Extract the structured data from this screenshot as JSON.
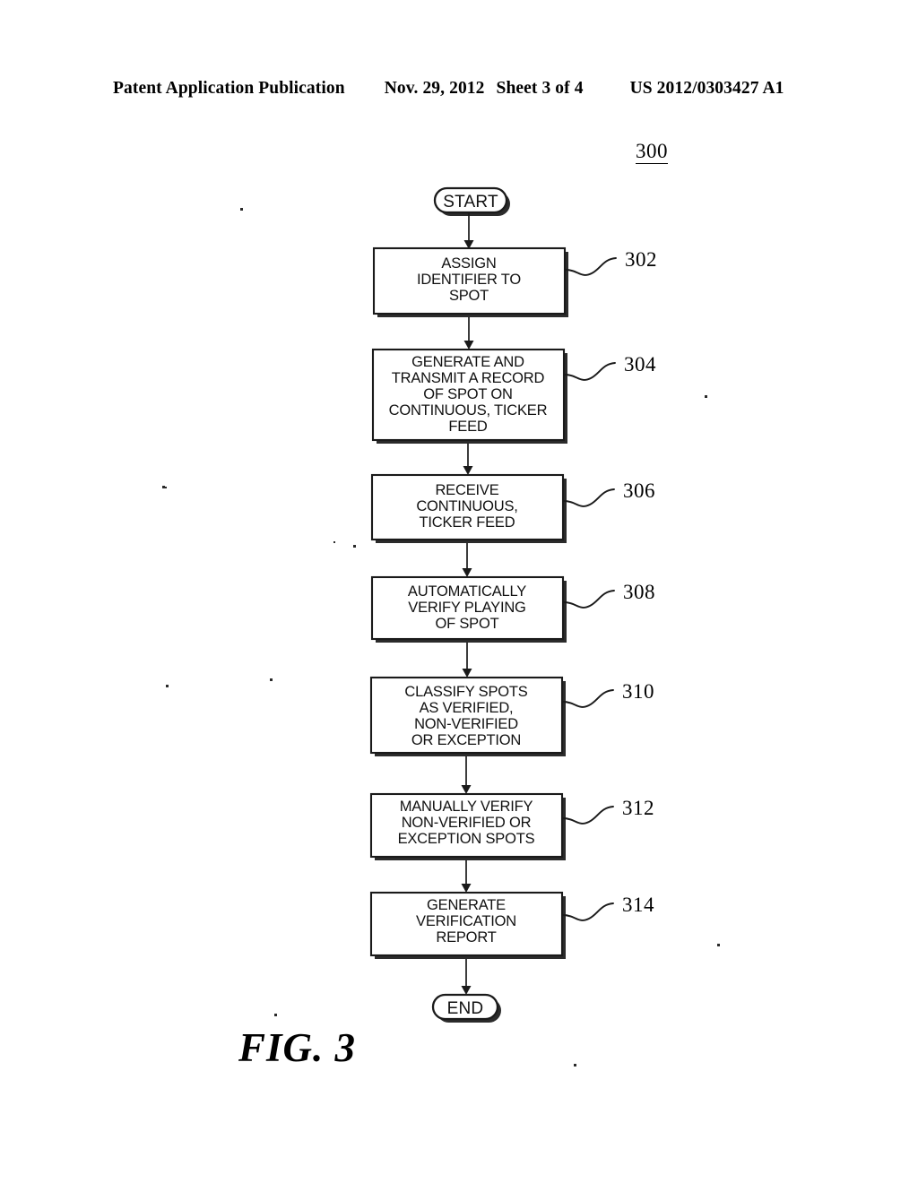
{
  "header": {
    "publication": "Patent Application Publication",
    "date": "Nov. 29, 2012",
    "sheet": "Sheet 3 of 4",
    "patent_number": "US 2012/0303427 A1"
  },
  "figure": {
    "diagram_ref": "300",
    "caption": "FIG. 3"
  },
  "flowchart": {
    "start_label": "START",
    "end_label": "END",
    "steps": [
      {
        "ref": "302",
        "lines": [
          "ASSIGN",
          "IDENTIFIER TO",
          "SPOT"
        ]
      },
      {
        "ref": "304",
        "lines": [
          "GENERATE AND",
          "TRANSMIT A RECORD",
          "OF SPOT ON",
          "CONTINUOUS, TICKER",
          "FEED"
        ]
      },
      {
        "ref": "306",
        "lines": [
          "RECEIVE",
          "CONTINUOUS,",
          "TICKER FEED"
        ]
      },
      {
        "ref": "308",
        "lines": [
          "AUTOMATICALLY",
          "VERIFY PLAYING",
          "OF SPOT"
        ]
      },
      {
        "ref": "310",
        "lines": [
          "CLASSIFY SPOTS",
          "AS VERIFIED,",
          "NON-VERIFIED",
          "OR EXCEPTION"
        ]
      },
      {
        "ref": "312",
        "lines": [
          "MANUALLY VERIFY",
          "NON-VERIFIED OR",
          "EXCEPTION SPOTS"
        ]
      },
      {
        "ref": "314",
        "lines": [
          "GENERATE",
          "VERIFICATION",
          "REPORT"
        ]
      }
    ]
  },
  "colors": {
    "ink": "#1a1a1a",
    "paper": "#ffffff"
  }
}
